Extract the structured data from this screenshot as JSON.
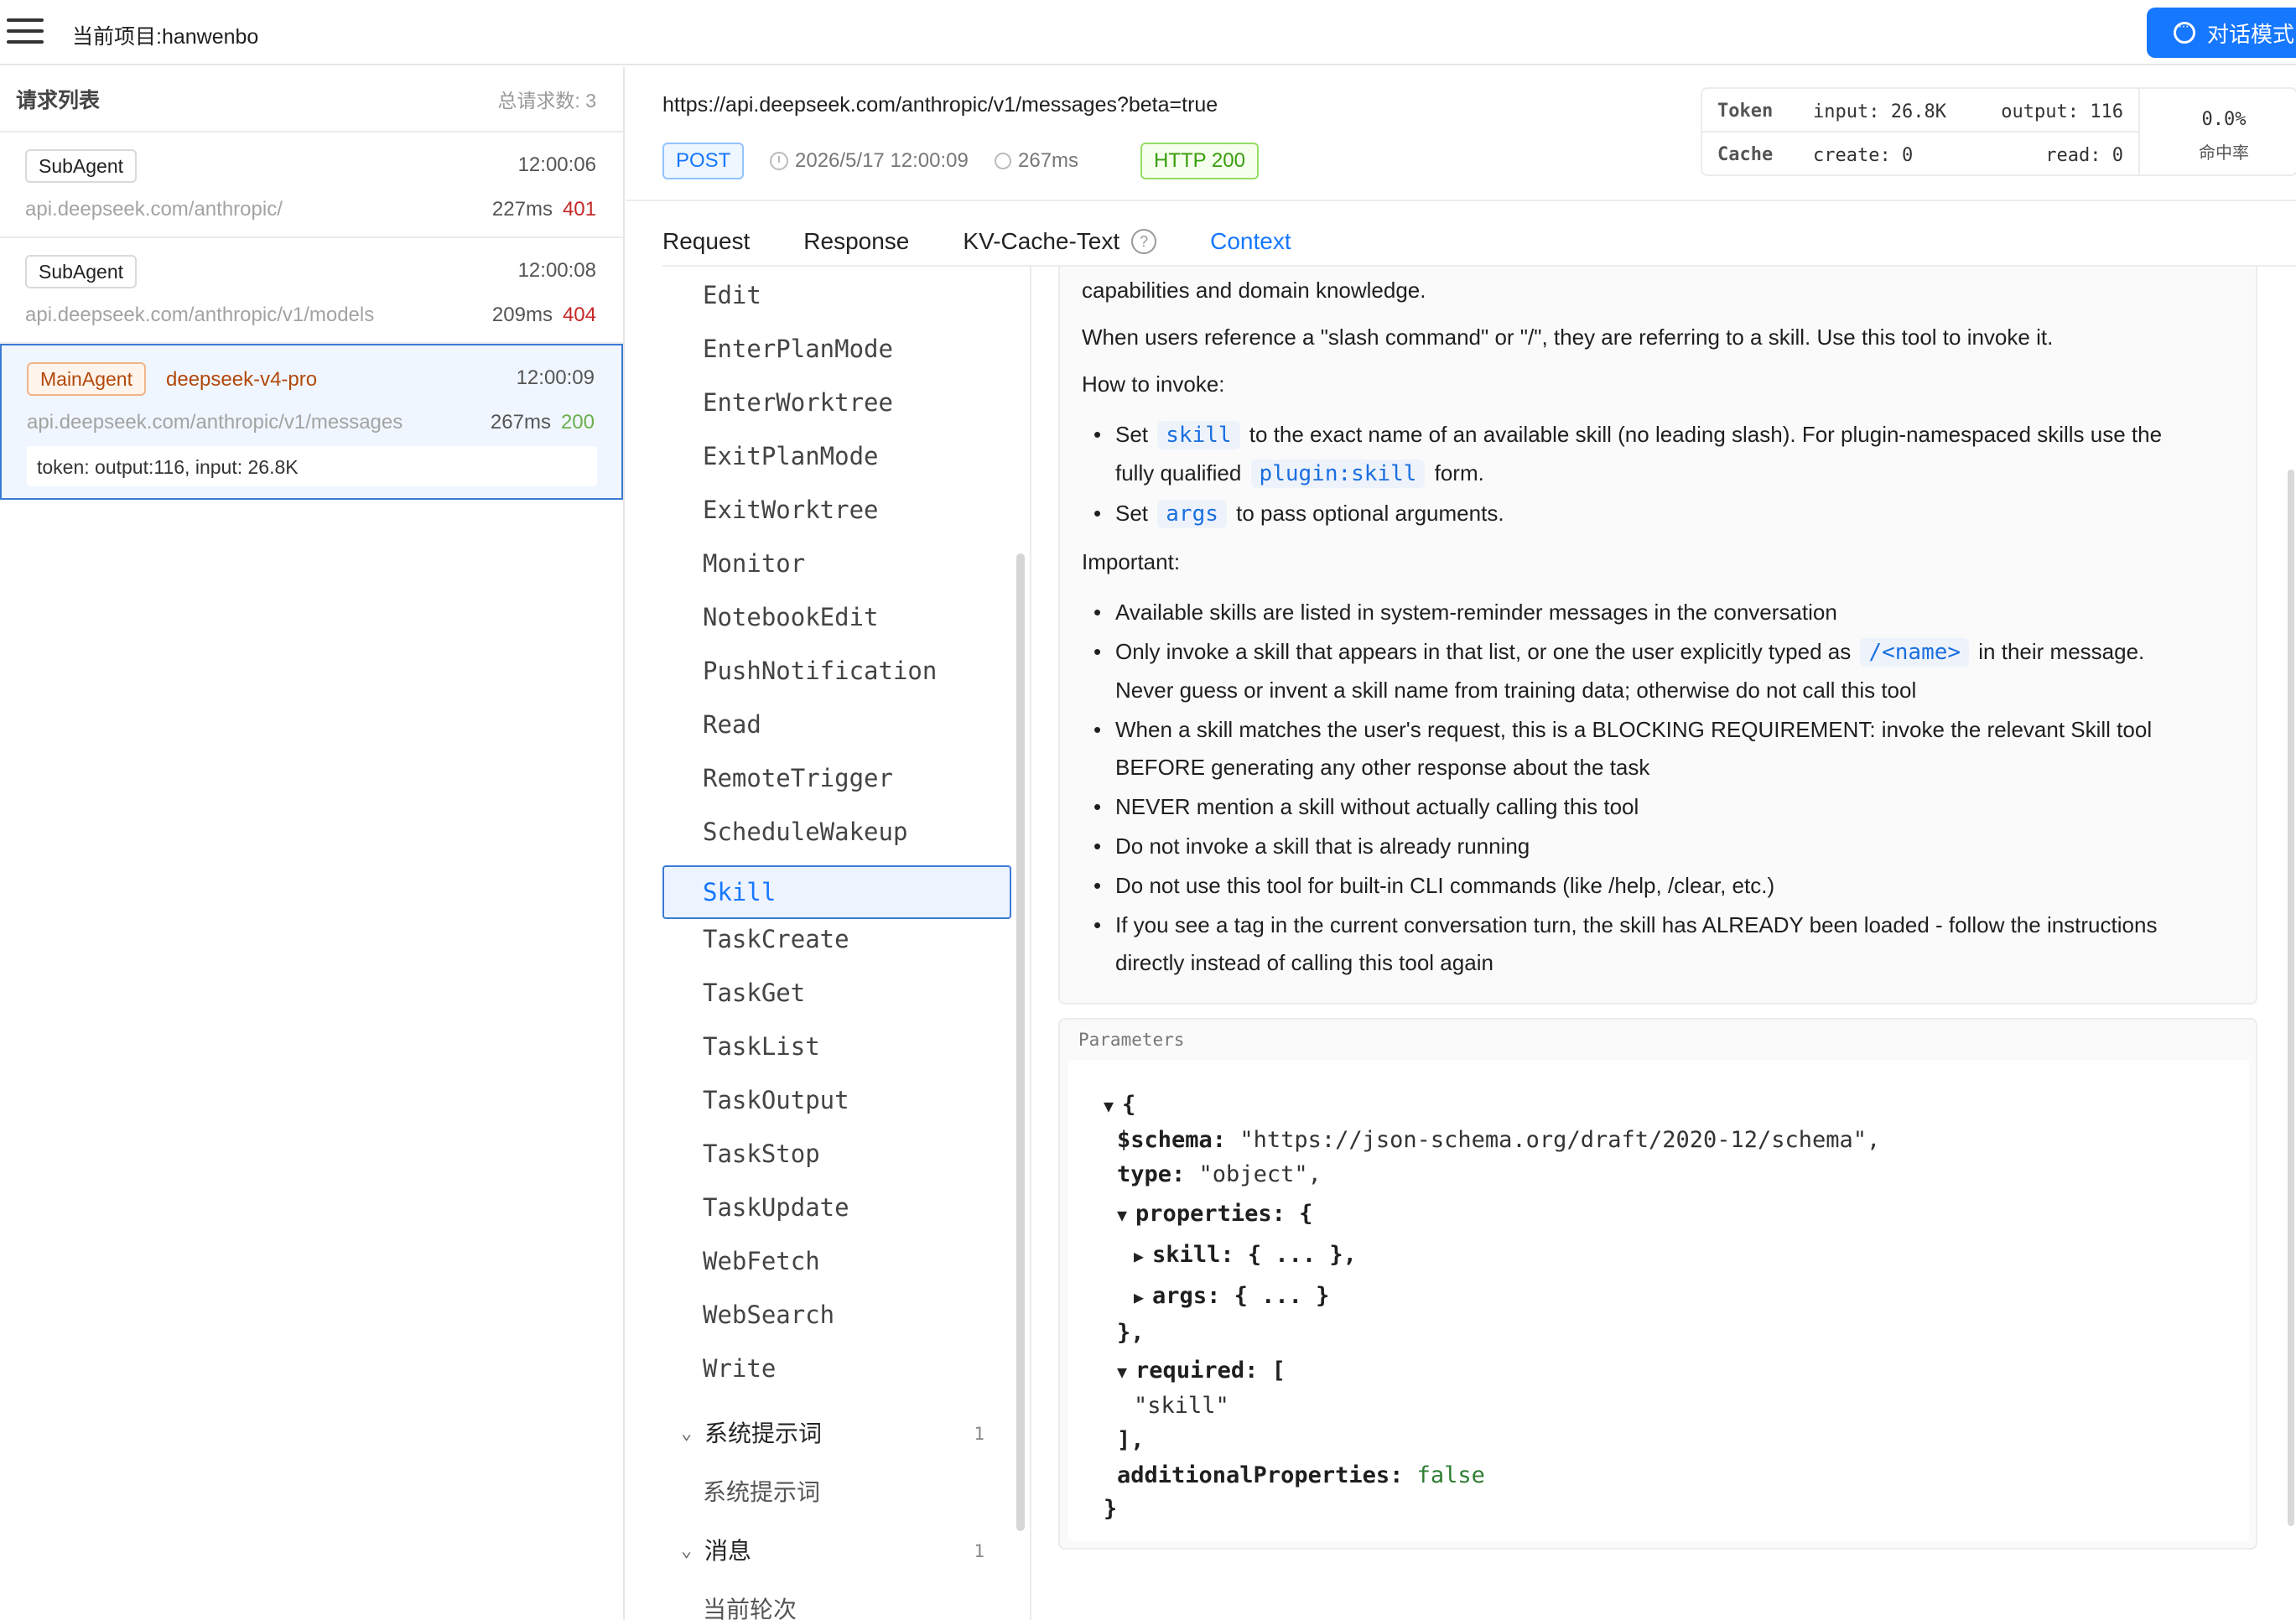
{
  "topbar": {
    "project_label": "当前项目:hanwenbo",
    "chat_button": "对话模式"
  },
  "request_list": {
    "title": "请求列表",
    "total": "总请求数: 3",
    "items": [
      {
        "agent": "SubAgent",
        "model": "",
        "time": "12:00:06",
        "url": "api.deepseek.com/anthropic/",
        "duration": "227ms",
        "status": "401"
      },
      {
        "agent": "SubAgent",
        "model": "",
        "time": "12:00:08",
        "url": "api.deepseek.com/anthropic/v1/models",
        "duration": "209ms",
        "status": "404"
      },
      {
        "agent": "MainAgent",
        "model": "deepseek-v4-pro",
        "time": "12:00:09",
        "url": "api.deepseek.com/anthropic/v1/messages",
        "duration": "267ms",
        "status": "200",
        "token_info": "token: output:116, input: 26.8K"
      }
    ]
  },
  "detail": {
    "url": "https://api.deepseek.com/anthropic/v1/messages?beta=true",
    "method": "POST",
    "datetime": "2026/5/17 12:00:09",
    "duration": "267ms",
    "http_status": "HTTP 200",
    "stats": {
      "token_label": "Token",
      "input": "input: 26.8K",
      "output": "output: 116",
      "cache_label": "Cache",
      "create": "create: 0",
      "read": "read: 0",
      "hit_rate": "0.0%",
      "hit_label": "命中率"
    }
  },
  "tabs": [
    {
      "label": "Request"
    },
    {
      "label": "Response"
    },
    {
      "label": "KV-Cache-Text",
      "help": "?"
    },
    {
      "label": "Context",
      "active": true
    }
  ],
  "tools": [
    "Edit",
    "EnterPlanMode",
    "EnterWorktree",
    "ExitPlanMode",
    "ExitWorktree",
    "Monitor",
    "NotebookEdit",
    "PushNotification",
    "Read",
    "RemoteTrigger",
    "ScheduleWakeup",
    "Skill",
    "TaskCreate",
    "TaskGet",
    "TaskList",
    "TaskOutput",
    "TaskStop",
    "TaskUpdate",
    "WebFetch",
    "WebSearch",
    "Write"
  ],
  "selected_tool": "Skill",
  "groups": [
    {
      "label": "系统提示词",
      "count": "1",
      "child": "系统提示词"
    },
    {
      "label": "消息",
      "count": "1",
      "child": "当前轮次"
    }
  ],
  "description": {
    "p1": "capabilities and domain knowledge.",
    "p2": "When users reference a \"slash command\" or \"/\", they are referring to a skill. Use this tool to invoke it.",
    "p3": "How to invoke:",
    "invoke": {
      "b1_pre": "Set",
      "b1_code": "skill",
      "b1_mid": "to the exact name of an available skill (no leading slash). For plugin-namespaced skills use the",
      "b1_line2_pre": "fully qualified",
      "b1_code2": "plugin:skill",
      "b1_line2_post": "form.",
      "b2_pre": "Set",
      "b2_code": "args",
      "b2_post": "to pass optional arguments."
    },
    "p4": "Important:",
    "important": {
      "i1": "Available skills are listed in system-reminder messages in the conversation",
      "i2_pre": "Only invoke a skill that appears in that list, or one the user explicitly typed as",
      "i2_code": "/<name>",
      "i2_post": "in their message.",
      "i2_line2": "Never guess or invent a skill name from training data; otherwise do not call this tool",
      "i3": "When a skill matches the user's request, this is a BLOCKING REQUIREMENT: invoke the relevant Skill tool",
      "i3_line2": "BEFORE generating any other response about the task",
      "i4": "NEVER mention a skill without actually calling this tool",
      "i5": "Do not invoke a skill that is already running",
      "i6": "Do not use this tool for built-in CLI commands (like /help, /clear, etc.)",
      "i7": "If you see a tag in the current conversation turn, the skill has ALREADY been loaded - follow the instructions",
      "i7_line2": "directly instead of calling this tool again"
    }
  },
  "parameters": {
    "label": "Parameters",
    "open_brace": "{",
    "schema_key": "$schema:",
    "schema_val": "\"https://json-schema.org/draft/2020-12/schema\",",
    "type_key": "type:",
    "type_val": "\"object\",",
    "properties_key": "properties:",
    "properties_open": "{",
    "skill_key": "skill:",
    "skill_val": "{ ... },",
    "args_key": "args:",
    "args_val": "{ ... }",
    "properties_close": "},",
    "required_key": "required:",
    "required_open": "[",
    "required_item": "\"skill\"",
    "required_close": "],",
    "additional_key": "additionalProperties:",
    "additional_val": "false",
    "close_brace": "}"
  }
}
